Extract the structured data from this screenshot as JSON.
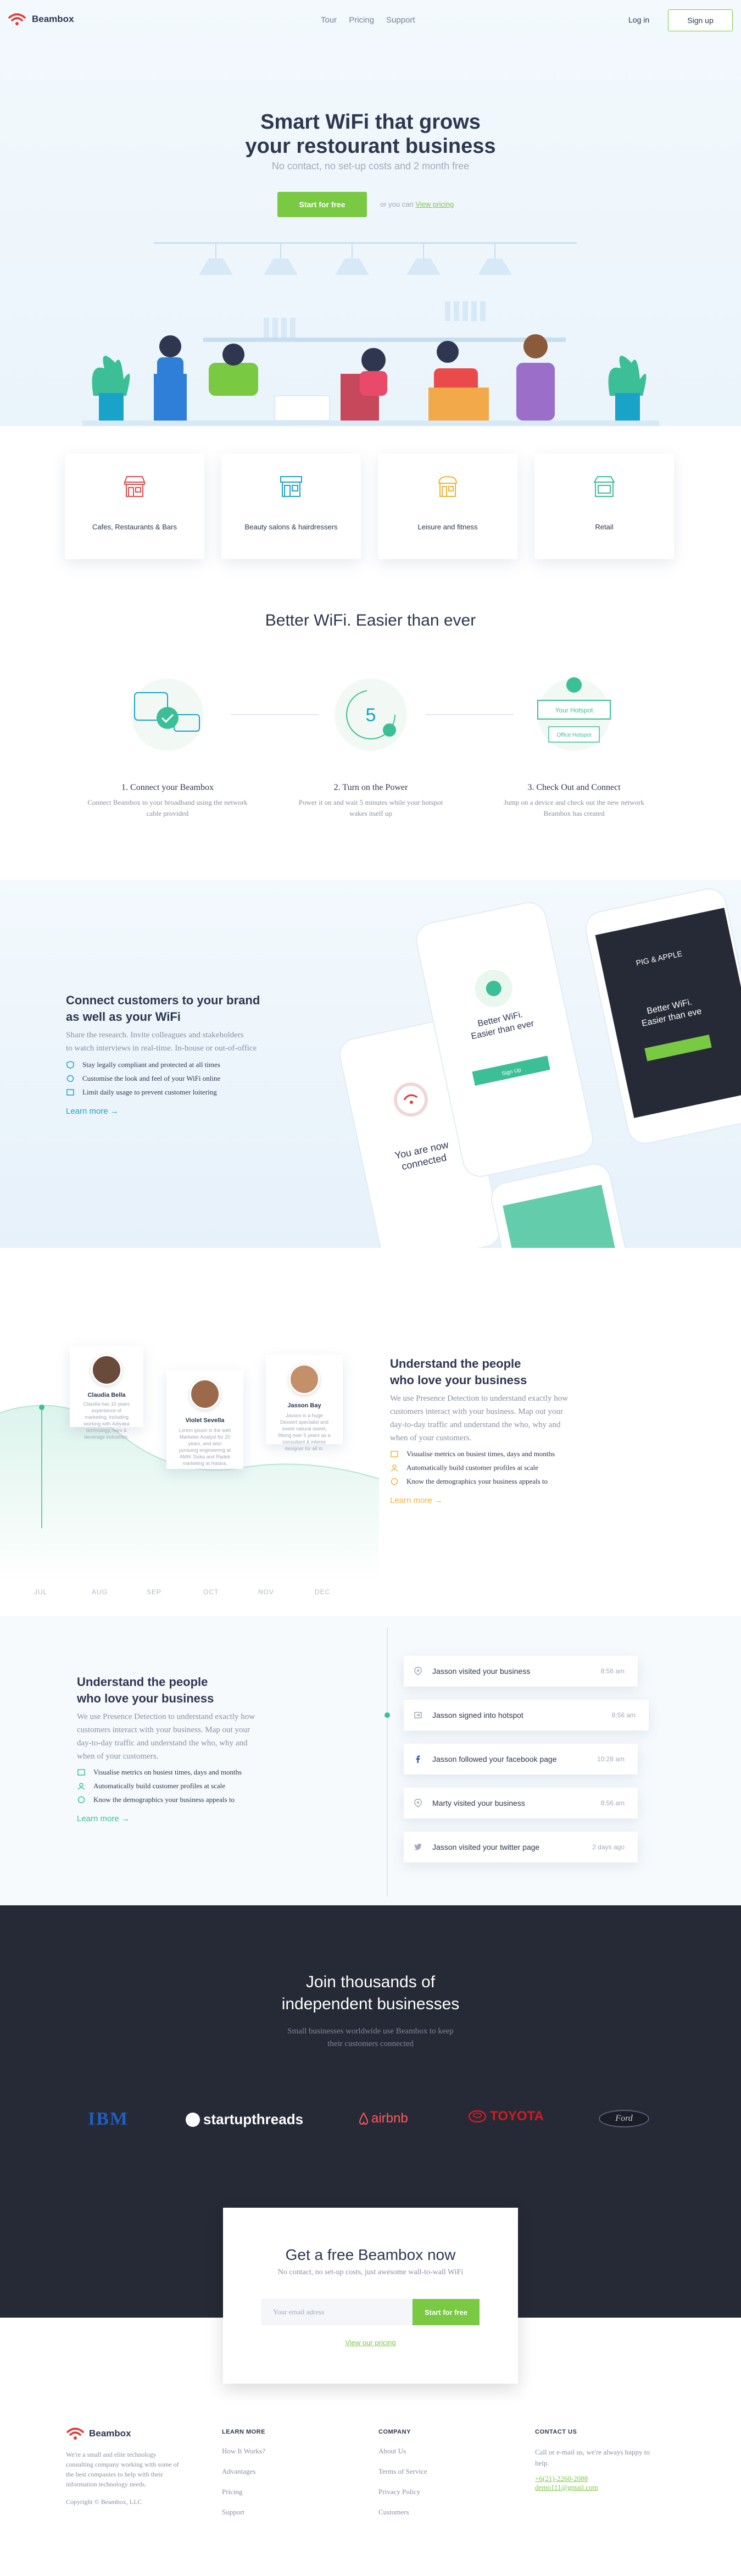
{
  "brand": {
    "name": "Beambox",
    "accent": "#7ac943",
    "logo_color": "#e53935",
    "dark_bg": "#262a36"
  },
  "nav": {
    "links": [
      "Tour",
      "Pricing",
      "Support"
    ],
    "login": "Log in",
    "signup": "Sign up"
  },
  "hero": {
    "title_line1": "Smart WiFi that grows",
    "title_line2": "your restourant business",
    "subtitle": "No contact, no set-up costs and 2 month free",
    "cta": "Start for free",
    "or_text": "or you can",
    "view_pricing": "View pricing"
  },
  "categories": [
    {
      "label": "Cafes, Restaurants & Bars",
      "icon": "storefront-icon",
      "color": "#e94a4a"
    },
    {
      "label": "Beauty salons & hairdressers",
      "icon": "salon-icon",
      "color": "#1aa3c9"
    },
    {
      "label": "Leisure and fitness",
      "icon": "shop-icon",
      "color": "#f2b236"
    },
    {
      "label": "Retail",
      "icon": "retail-icon",
      "color": "#3cbf96"
    }
  ],
  "better": {
    "title": "Better WiFi. Easier than ever",
    "steps": [
      {
        "title": "1. Connect your Beambox",
        "desc_line1": "Connect Beambox to your broadband using the network",
        "desc_line2": "cable provided",
        "icon": "router-check-icon"
      },
      {
        "title": "2. Turn on the Power",
        "desc_line1": "Power it on and wait 5 minutes while your hotspot",
        "desc_line2": "wakes itself up",
        "icon": "timer-icon",
        "timer": "5"
      },
      {
        "title": "3. Check Out and Connect",
        "desc_line1": "Jump on a device and check out the new network",
        "desc_line2": "Beambox has created",
        "icon": "hotspot-icon",
        "ssid1": "Your Hotspot",
        "ssid2": "Office Hotspot"
      }
    ]
  },
  "connect": {
    "title_line1": "Connect customers to your brand",
    "title_line2": "as well as your WiFi",
    "desc_line1": "Share the research. Invite colleagues and stakeholders",
    "desc_line2": "to watch interviews in real-time. In-house or out-of-office",
    "features": [
      "Stay legally compliant and protected at all times",
      "Customise the look and feel of your WiFi online",
      "Limit daily usage to prevent customer loitering"
    ],
    "more": "Learn more",
    "phone": {
      "connected_line1": "You are now",
      "connected_line2": "connected",
      "better_line1": "Better WiFi.",
      "better_line2": "Easier than ever",
      "signup": "Sign Up",
      "brand_line1": "PIG & APPLE",
      "brand_line2": "Better WiFi.",
      "brand_line3": "Easier than eve"
    }
  },
  "presence": {
    "title_line1": "Understand the people",
    "title_line2": "who love your business",
    "desc_line1": "We use Presence Detection to understand exactly how",
    "desc_line2": "customers interact with your business. Map out your",
    "desc_line3": "day-to-day traffic and understand the who, why and",
    "desc_line4": "when of your customers.",
    "features": [
      "Visualise metrics on busiest times, days and months",
      "Automatically build customer profiles at scale",
      "Know the demographics your business appeals to"
    ],
    "more": "Learn more",
    "accent": "#f2b236",
    "profiles": [
      {
        "name": "Claudia Bella",
        "bio": "Claudia has 10 years experience of marketing, including working with Adiyaka technology, bars & beverage industries."
      },
      {
        "name": "Violet Sevella",
        "bio": "Lorem ipsum is the web Marketer Analyst for 20 years, and also pursuing engineering at AMIK Siska and Radek marketing at Hatara."
      },
      {
        "name": "Jasson Bay",
        "bio": "Jasson is a huge Dessert specialist and sweet natural sweet, lifeing over 5 years as a consultant & interior designer for all in."
      }
    ],
    "months": [
      "JUL",
      "AUG",
      "SEP",
      "OCT",
      "NOV",
      "DEC"
    ]
  },
  "activity": {
    "title_line1": "Understand the people",
    "title_line2": "who love your business",
    "desc_line1": "We use Presence Detection to understand exactly how",
    "desc_line2": "customers interact with your business. Map out your",
    "desc_line3": "day-to-day traffic and understand the who, why and",
    "desc_line4": "when of your customers.",
    "features": [
      "Visualise metrics on busiest times, days and months",
      "Automatically build customer profiles at scale",
      "Know the demographics your business appeals to"
    ],
    "more": "Learn more",
    "events": [
      {
        "text": "Jasson visited your business",
        "time": "8:56 am",
        "icon": "location-pin-icon"
      },
      {
        "text": "Jasson signed into hotspot",
        "time": "8:56 am",
        "icon": "sign-in-icon"
      },
      {
        "text": "Jasson followed your facebook page",
        "time": "10:28 am",
        "icon": "facebook-icon"
      },
      {
        "text": "Marty visited your business",
        "time": "8:56 am",
        "icon": "location-pin-icon"
      },
      {
        "text": "Jasson visited your twitter page",
        "time": "2 days ago",
        "icon": "twitter-icon"
      }
    ]
  },
  "join": {
    "title_line1": "Join thousands of",
    "title_line2": "independent businesses",
    "sub_line1": "Small businesses worldwide use Beambox to keep",
    "sub_line2": "their customers connected",
    "logos": [
      "IBM",
      "startupthreads",
      "airbnb",
      "TOYOTA",
      "Ford"
    ]
  },
  "getfree": {
    "title": "Get a free Beambox now",
    "sub": "No contact, no set-up costs, just awesome wall-to-wall WiFi",
    "placeholder": "Your email adress",
    "button": "Start for free",
    "pricing": "View our pricing"
  },
  "footer": {
    "about_line1": "We're a small and elite technology",
    "about_line2": "consulting company working with some of",
    "about_line3": "the best companies to help with their",
    "about_line4": "information technology needs.",
    "copyright": "Copyright © Beambox, LLC",
    "learn": {
      "title": "LEARN MORE",
      "links": [
        "How It Works?",
        "Advantages",
        "Pricing",
        "Support"
      ]
    },
    "company": {
      "title": "COMPANY",
      "links": [
        "About Us",
        "Terms of Service",
        "Privacy Policy",
        "Customers"
      ]
    },
    "contact": {
      "title": "CONTACT US",
      "text_line1": "Call or e-mail us, we're always happy to",
      "text_line2": "help.",
      "phone": "+6(21)-2260-2088",
      "email": "demo111@gmail.com"
    }
  }
}
